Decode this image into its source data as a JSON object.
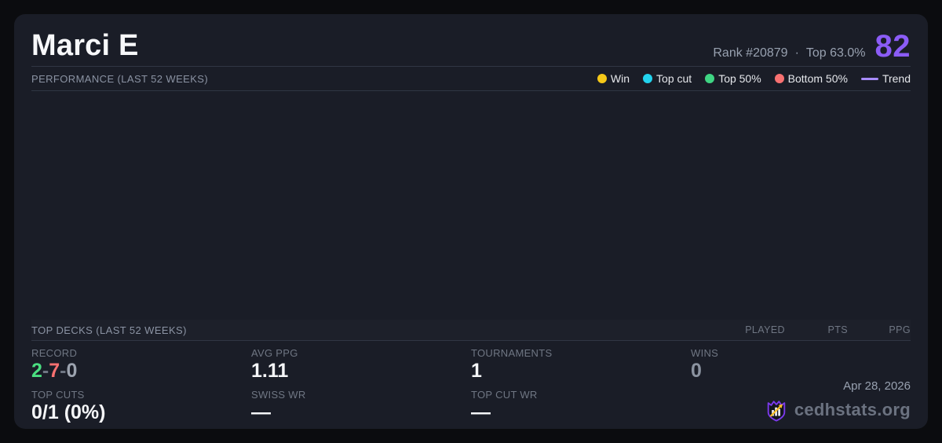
{
  "header": {
    "player_name": "Marci E",
    "rank_text": "Rank #20879",
    "separator": "·",
    "top_percent": "Top 63.0%",
    "score": "82"
  },
  "performance": {
    "title": "PERFORMANCE (LAST 52 WEEKS)",
    "legend": [
      {
        "label": "Win",
        "color": "#f5c818",
        "type": "dot"
      },
      {
        "label": "Top cut",
        "color": "#22d3ee",
        "type": "dot"
      },
      {
        "label": "Top 50%",
        "color": "#3fd583",
        "type": "dot"
      },
      {
        "label": "Bottom 50%",
        "color": "#f87171",
        "type": "dot"
      },
      {
        "label": "Trend",
        "color": "#a78bfa",
        "type": "line"
      }
    ],
    "chart": {
      "empty": true,
      "points": []
    }
  },
  "top_decks": {
    "title": "TOP DECKS (LAST 52 WEEKS)",
    "columns": [
      "PLAYED",
      "PTS",
      "PPG"
    ],
    "rows": []
  },
  "stats": {
    "record": {
      "label": "RECORD",
      "wins": "2",
      "sep": "-",
      "losses": "7",
      "draws": "0"
    },
    "top_cuts": {
      "label": "TOP CUTS",
      "value": "0/1 (0%)"
    },
    "avg_ppg": {
      "label": "AVG PPG",
      "value": "1.11"
    },
    "swiss_wr": {
      "label": "SWISS WR",
      "value": "—"
    },
    "tournaments": {
      "label": "TOURNAMENTS",
      "value": "1"
    },
    "top_cut_wr": {
      "label": "TOP CUT WR",
      "value": "—"
    },
    "wins": {
      "label": "WINS",
      "value": "0"
    }
  },
  "footer": {
    "date": "Apr 28, 2026",
    "brand": "cedhstats.org"
  },
  "colors": {
    "score": "#8b5cf6",
    "record_win": "#4ade80",
    "record_loss": "#f87171",
    "record_draw": "#9ca3af",
    "brand_shield": "#7c3aed",
    "brand_arrow": "#fbbf24"
  }
}
